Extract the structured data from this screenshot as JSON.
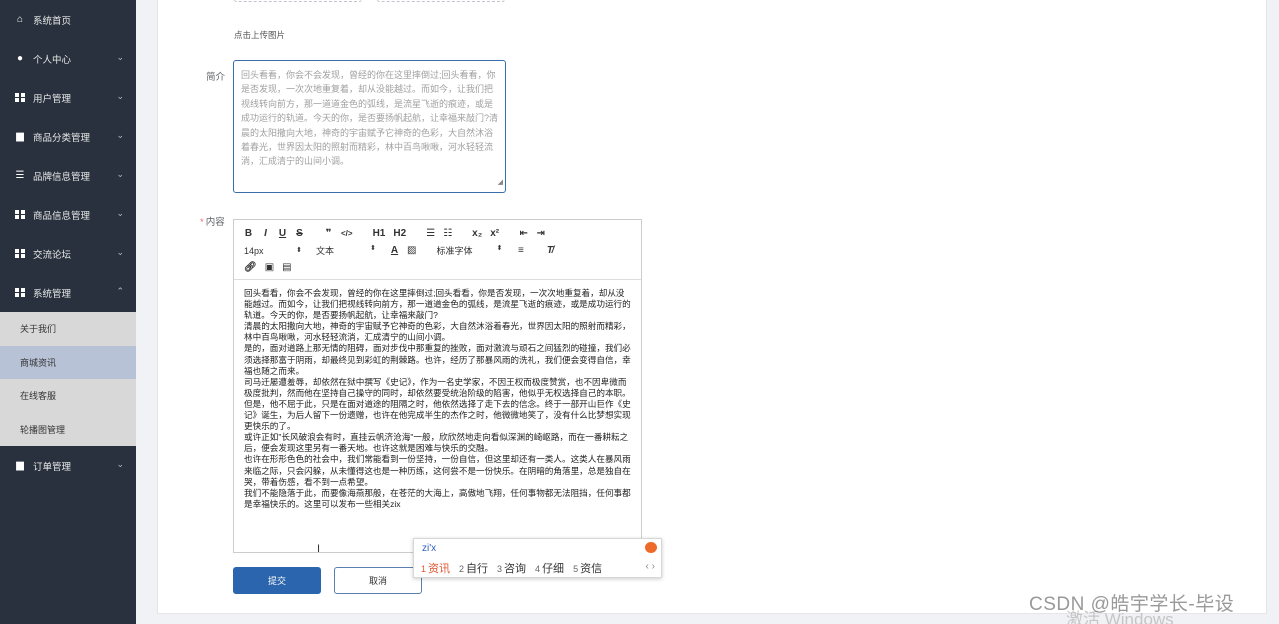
{
  "sidebar": {
    "items": [
      {
        "label": "系统首页",
        "icon": "home-icon",
        "chevron": ""
      },
      {
        "label": "个人中心",
        "icon": "user-icon",
        "chevron": "⌄"
      },
      {
        "label": "用户管理",
        "icon": "grid-icon",
        "chevron": "⌄"
      },
      {
        "label": "商品分类管理",
        "icon": "display-icon",
        "chevron": "⌄"
      },
      {
        "label": "品牌信息管理",
        "icon": "sliders-icon",
        "chevron": "⌄"
      },
      {
        "label": "商品信息管理",
        "icon": "grid-icon",
        "chevron": "⌄"
      },
      {
        "label": "交流论坛",
        "icon": "grid-icon",
        "chevron": "⌄"
      },
      {
        "label": "系统管理",
        "icon": "grid-icon",
        "chevron": "⌃"
      }
    ],
    "submenu": [
      {
        "label": "关于我们"
      },
      {
        "label": "商城资讯"
      },
      {
        "label": "在线客服"
      },
      {
        "label": "轮播图管理"
      }
    ],
    "bottom": {
      "label": "订单管理",
      "icon": "monitor-icon",
      "chevron": "⌄"
    }
  },
  "form": {
    "upload_hint": "点击上传图片",
    "intro_label": "简介",
    "intro_text": "回头看看，你会不会发现，曾经的你在这里摔倒过;回头看看，你是否发现，一次次地重复着，却从没能越过。而如今，让我们把视线转向前方，那一道道金色的弧线，是流星飞逝的痕迹，或是成功运行的轨道。今天的你，是否要扬帆起航，让幸福来敲门?清晨的太阳撒向大地，神奇的宇宙赋予它神奇的色彩，大自然沐浴着春光，世界因太阳的照射而精彩，林中百鸟啾啾，河水轻轻流淌，汇成清宁的山间小调。",
    "content_label": "内容",
    "required_mark": "*",
    "submit_label": "提交",
    "cancel_label": "取消"
  },
  "editor": {
    "toolbar_row1": [
      "B",
      "I",
      "U",
      "S",
      "❞",
      "</>",
      "H1",
      "H2",
      "☰",
      "☷",
      "x₂",
      "x²",
      "⇤",
      "⇥"
    ],
    "font_size": "14px",
    "text_type": "文本",
    "font_family": "标准字体",
    "paragraphs": [
      "回头看看，你会不会发现，曾经的你在这里摔倒过;回头看看，你是否发现，一次次地重复着，却从没能越过。而如今，让我们把视线转向前方，那一道道金色的弧线，是流星飞逝的痕迹，或是成功运行的轨道。今天的你，是否要扬帆起航，让幸福来敲门?",
      "清晨的太阳撒向大地，神奇的宇宙赋予它神奇的色彩，大自然沐浴着春光，世界因太阳的照射而精彩，林中百鸟啾啾，河水轻轻流淌，汇成清宁的山间小调。",
      "是的，面对道路上那无情的阻碍，面对步伐中那重复的挫败，面对激流与顽石之间猛烈的碰撞，我们必须选择那富于阴雨，却最终见到彩虹的荆棘路。也许，经历了那暴风雨的洗礼，我们便会变得自信，幸福也随之而来。",
      "司马迁屡遭羞辱，却依然在狱中撰写《史记》，作为一名史学家，不因王权而极度赞赏，也不因卑微而极度批判，然而他在坚持自己操守的同时，却依然要受统治阶级的陷害，他似乎无权选择自己的本职。但是，他不屈于此，只是在面对道途的阻隔之时，他依然选择了走下去的信念。终于一部开山巨作《史记》诞生，为后人留下一份遗赠，也许在他完成半生的杰作之时，他微微地笑了，没有什么比梦想实现更快乐的了。",
      "或许正如\"长风破浪会有时，直挂云帆济沧海\"一般，欣欣然地走向看似深渊的崎岖路，而在一番耕耘之后，便会发现这里另有一番天地。也许这就是困难与快乐的交融。",
      "也许在形形色色的社会中，我们常能看到一份坚持，一份自信，但这里却还有一类人。这类人在暴风雨来临之际，只会闪躲，从未懂得这也是一种历练，这何尝不是一份快乐。在阴暗的角落里，总是独自在哭，带着伤感，看不到一点希望。",
      "我们不能隐落于此，而要像海燕那般，在苍茫的大海上，高傲地飞翔，任何事物都无法阻挡，任何事都是幸福快乐的。这里可以发布一些相关zix"
    ]
  },
  "ime": {
    "composition": "zi'x",
    "candidates": [
      {
        "num": "1",
        "text": "资讯"
      },
      {
        "num": "2",
        "text": "自行"
      },
      {
        "num": "3",
        "text": "咨询"
      },
      {
        "num": "4",
        "text": "仔细"
      },
      {
        "num": "5",
        "text": "资信"
      }
    ],
    "arrows": "‹  ›"
  },
  "watermark": {
    "csdn": "CSDN @皓宇学长-毕设",
    "windows": "激活 Windows"
  }
}
